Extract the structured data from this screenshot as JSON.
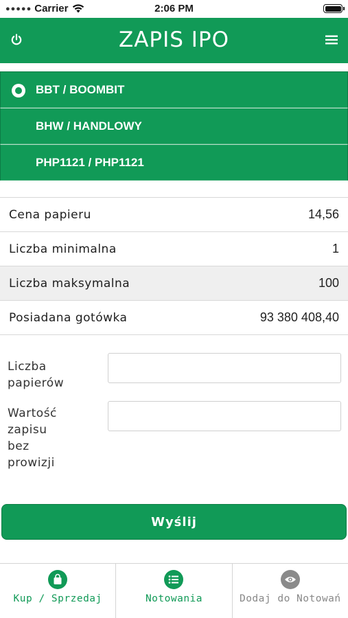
{
  "status_bar": {
    "carrier": "Carrier",
    "time": "2:06 PM"
  },
  "header": {
    "title": "ZAPIS IPO",
    "power_icon": "power-icon",
    "menu_icon": "hamburger-menu-icon"
  },
  "instruments": [
    {
      "label": "BBT / BOOMBIT",
      "selected": true
    },
    {
      "label": "BHW / HANDLOWY",
      "selected": false
    },
    {
      "label": "PHP1121 / PHP1121",
      "selected": false
    }
  ],
  "info": {
    "rows": [
      {
        "label": "Cena papieru",
        "value": "14,56"
      },
      {
        "label": "Liczba minimalna",
        "value": "1"
      },
      {
        "label": "Liczba maksymalna",
        "value": "100"
      },
      {
        "label": "Posiadana gotówka",
        "value": "93 380 408,40"
      }
    ]
  },
  "form": {
    "quantity_label": "Liczba\npapierów",
    "quantity_value": "",
    "value_label": "Wartość\nzapisu\nbez\nprowizji",
    "value_value": ""
  },
  "submit_label": "Wyślij",
  "tabs": [
    {
      "label": "Kup / Sprzedaj",
      "icon": "shopping-bag-icon",
      "state": "active"
    },
    {
      "label": "Notowania",
      "icon": "list-icon",
      "state": "active"
    },
    {
      "label": "Dodaj do Notowań",
      "icon": "eye-icon",
      "state": "inactive"
    }
  ],
  "colors": {
    "brand_green": "#119a57",
    "inactive_gray": "#888888"
  }
}
